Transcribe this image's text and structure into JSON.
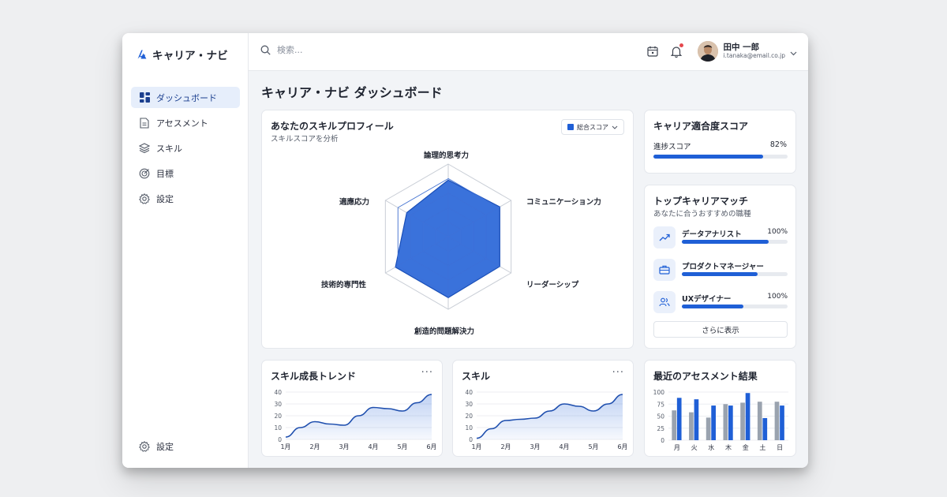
{
  "app": {
    "brand": "キャリア・ナビ"
  },
  "sidebar": {
    "items": [
      {
        "label": "ダッシュボード",
        "icon": "dashboard-icon",
        "active": true
      },
      {
        "label": "アセスメント",
        "icon": "document-icon"
      },
      {
        "label": "スキル",
        "icon": "layers-icon"
      },
      {
        "label": "目標",
        "icon": "target-icon"
      },
      {
        "label": "設定",
        "icon": "gear-icon"
      }
    ],
    "bottom_item": {
      "label": "設定",
      "icon": "gear-icon"
    }
  },
  "topbar": {
    "search_placeholder": "検索...",
    "user_name": "田中 一郎",
    "user_email": "i.tanaka@email.co.jp",
    "notification_dot": true
  },
  "page": {
    "title": "キャリア・ナビ ダッシュボード"
  },
  "skill_profile": {
    "title": "あなたのスキルプロフィール",
    "subtitle": "スキルスコアを分析",
    "dropdown_label": "総合スコア",
    "axes": [
      "論理的思考力",
      "コミュニケーション力",
      "リーダーシップ",
      "創造的問題解決力",
      "技術的専門性",
      "適應応力"
    ],
    "values": [
      0.78,
      0.82,
      0.82,
      0.84,
      0.84,
      0.66
    ],
    "color": "#1f5fd6"
  },
  "career_fit": {
    "title": "キャリア適合度スコア",
    "progress_label": "進捗スコア",
    "progress_value": "82%",
    "progress_fraction": 0.82
  },
  "top_match": {
    "title": "トップキャリアマッチ",
    "subtitle": "あなたに合うおすすめの職種",
    "items": [
      {
        "name": "データアナリスト",
        "value": "100%",
        "fraction": 0.82,
        "icon": "trend-up-icon"
      },
      {
        "name": "プロダクトマネージャー",
        "value": "",
        "fraction": 0.72,
        "icon": "briefcase-icon"
      },
      {
        "name": "UXデザイナー",
        "value": "100%",
        "fraction": 0.58,
        "icon": "users-icon"
      }
    ],
    "more_label": "さらに表示"
  },
  "chart_data": [
    {
      "type": "area",
      "title": "スキル成長トレンド",
      "categories": [
        "1月",
        "2月",
        "3月",
        "4月",
        "5月",
        "6月"
      ],
      "x": [
        0,
        0.5,
        1,
        1.5,
        2,
        2.5,
        3,
        3.5,
        4,
        4.5,
        5
      ],
      "values": [
        2,
        10,
        15,
        13,
        12,
        20,
        27,
        26,
        24,
        31,
        38
      ],
      "ylim": [
        0,
        40
      ],
      "yticks": [
        0,
        10,
        20,
        30,
        40
      ]
    },
    {
      "type": "area",
      "title": "スキル",
      "categories": [
        "1月",
        "2月",
        "3月",
        "4月",
        "5月",
        "6月"
      ],
      "x": [
        0,
        0.5,
        1,
        1.5,
        2,
        2.5,
        3,
        3.5,
        4,
        4.5,
        5
      ],
      "values": [
        1,
        9,
        16,
        17,
        18,
        24,
        30,
        28,
        24,
        30,
        38
      ],
      "ylim": [
        0,
        40
      ],
      "yticks": [
        0,
        10,
        20,
        30,
        40
      ]
    },
    {
      "type": "bar",
      "title": "最近のアセスメント結果",
      "categories": [
        "月",
        "火",
        "水",
        "木",
        "金",
        "土",
        "日"
      ],
      "series": [
        {
          "values": [
            62,
            58,
            47,
            75,
            78,
            80,
            80
          ],
          "color": "#9aa3af"
        },
        {
          "values": [
            88,
            85,
            72,
            72,
            98,
            46,
            72
          ],
          "color": "#1f5fd6"
        }
      ],
      "ylim": [
        0,
        100
      ],
      "yticks": [
        0,
        25,
        50,
        75,
        100
      ]
    }
  ]
}
